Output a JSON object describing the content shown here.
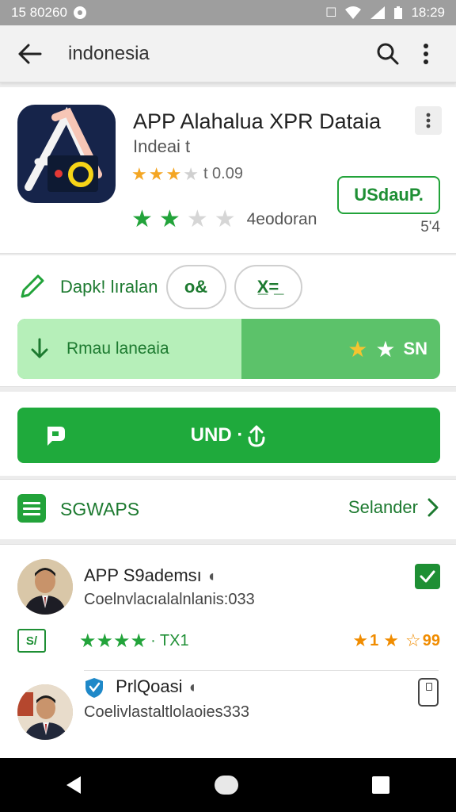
{
  "status_bar": {
    "left_text": "15 80260",
    "time": "18:29"
  },
  "top_bar": {
    "title": "indonesia",
    "back_icon": "back-arrow-icon",
    "search_icon": "search-icon",
    "menu_icon": "overflow-menu-icon"
  },
  "app": {
    "name": "APP Alahalua XPR Dataia",
    "developer": "Indeai t",
    "rating_text": "t 0.09",
    "rating_stars": 3,
    "downloads_text": "4eodoran",
    "downloads_stars": 2,
    "update_label": "USdauP.",
    "size_text": "5'4"
  },
  "actions": {
    "label": "Dapk! lıralan",
    "pill_1": "o&",
    "pill_2": "X̲=̲"
  },
  "progress": {
    "label": "Rmau laneaia",
    "right_text": "SN",
    "fraction": 0.53
  },
  "install": {
    "label": "UND ·"
  },
  "section": {
    "title": "SGWAPS",
    "link": "Selander"
  },
  "list": [
    {
      "name": "APP S9ademsı",
      "sub": "Coelnvlacıalalnlanis:033",
      "stat_box": "S/",
      "green_stat": "TX1",
      "orange_num1": "1",
      "orange_num2": "99"
    },
    {
      "name": "PrlQoasi",
      "sub": "Coelivlastaltlolaoies333"
    }
  ]
}
